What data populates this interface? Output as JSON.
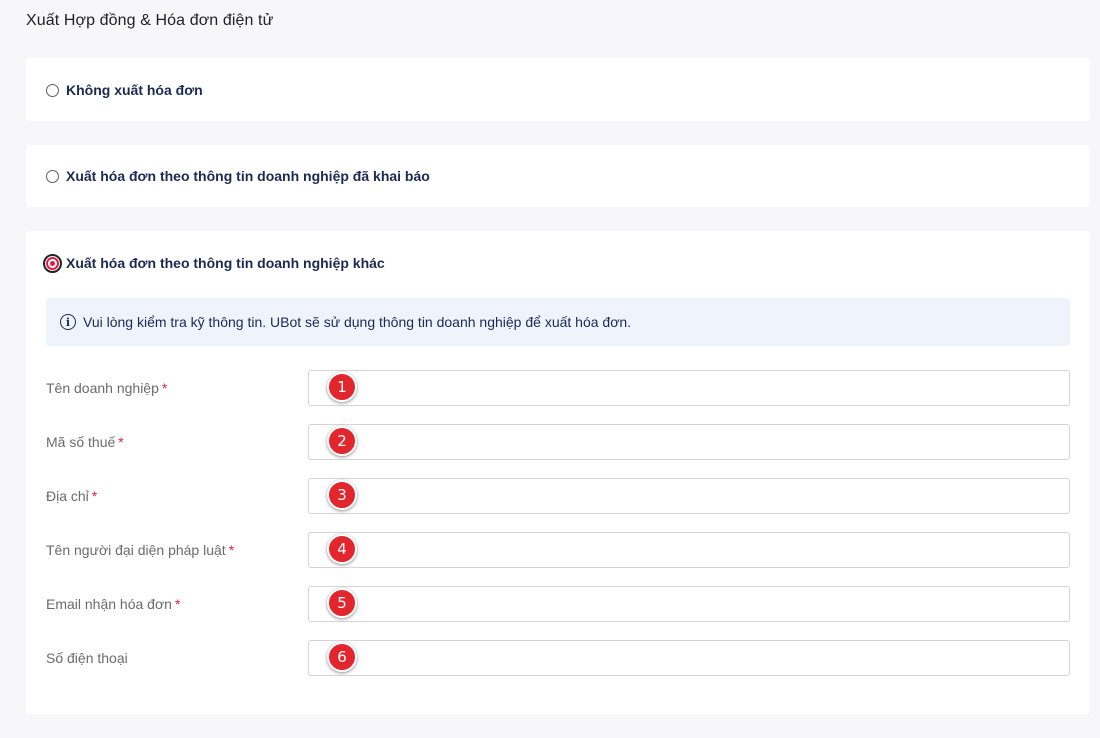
{
  "page": {
    "title": "Xuất Hợp đồng & Hóa đơn điện tử"
  },
  "options": [
    {
      "label": "Không xuất hóa đơn",
      "selected": false
    },
    {
      "label": "Xuất hóa đơn theo thông tin doanh nghiệp đã khai báo",
      "selected": false
    },
    {
      "label": "Xuất hóa đơn theo thông tin doanh nghiệp khác",
      "selected": true
    }
  ],
  "info": {
    "icon": "info-circle-icon",
    "text": "Vui lòng kiểm tra kỹ thông tin. UBot sẽ sử dụng thông tin doanh nghiệp để xuất hóa đơn."
  },
  "form": {
    "required_mark": "*",
    "fields": [
      {
        "label": "Tên doanh nghiệp",
        "required": true,
        "value": "",
        "marker": "1"
      },
      {
        "label": "Mã số thuế",
        "required": true,
        "value": "",
        "marker": "2"
      },
      {
        "label": "Địa chỉ",
        "required": true,
        "value": "",
        "marker": "3"
      },
      {
        "label": "Tên người đại diện pháp luật",
        "required": true,
        "value": "",
        "marker": "4"
      },
      {
        "label": "Email nhận hóa đơn",
        "required": true,
        "value": "",
        "marker": "5"
      },
      {
        "label": "Số điện thoại",
        "required": false,
        "value": "",
        "marker": "6"
      }
    ]
  },
  "colors": {
    "accent": "#e11d48",
    "marker": "#e3262d",
    "info_bg": "#eef3fc",
    "text_dark": "#1c2a52"
  }
}
